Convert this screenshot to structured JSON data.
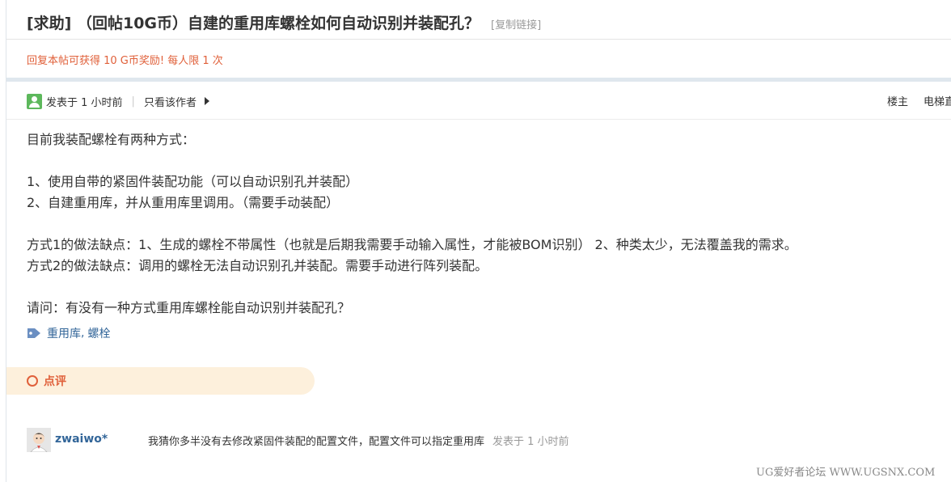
{
  "thread": {
    "title": "[求助] （回帖10G币）自建的重用库螺栓如何自动识别并装配孔？",
    "copy_link": "[复制链接]",
    "reward": "回复本帖可获得 10 G币奖励! 每人限 1 次"
  },
  "post": {
    "posted": "发表于 1 小时前",
    "separator": "|",
    "author_only": "只看该作者",
    "floor": "楼主",
    "elevator": "电梯直达",
    "paragraphs": [
      "目前我装配螺栓有两种方式：",
      "",
      "1、使用自带的紧固件装配功能（可以自动识别孔并装配）",
      "2、自建重用库，并从重用库里调用。（需要手动装配）",
      "",
      "方式1的做法缺点：1、生成的螺栓不带属性（也就是后期我需要手动输入属性，才能被BOM识别）   2、种类太少，无法覆盖我的需求。",
      "方式2的做法缺点：调用的螺栓无法自动识别孔并装配。需要手动进行阵列装配。",
      "",
      "请问：有没有一种方式重用库螺栓能自动识别并装配孔？"
    ],
    "tags": [
      "重用库",
      "螺栓"
    ],
    "tag_separator": ","
  },
  "comments": {
    "header": "点评",
    "items": [
      {
        "user": "zwaiwo*",
        "text": "我猜你多半没有去修改紧固件装配的配置文件，配置文件可以指定重用库",
        "time": "发表于 1 小时前"
      }
    ]
  },
  "watermark": "UG爱好者论坛 WWW.UGSNX.COM",
  "colors": {
    "accent": "#e0603a",
    "link": "#336699",
    "pill": "#fdf0dc",
    "band": "#dfe7ee"
  },
  "icons": [
    "online-user-icon",
    "arrow-right-icon",
    "tag-icon",
    "comment-ring-icon",
    "user-avatar"
  ]
}
